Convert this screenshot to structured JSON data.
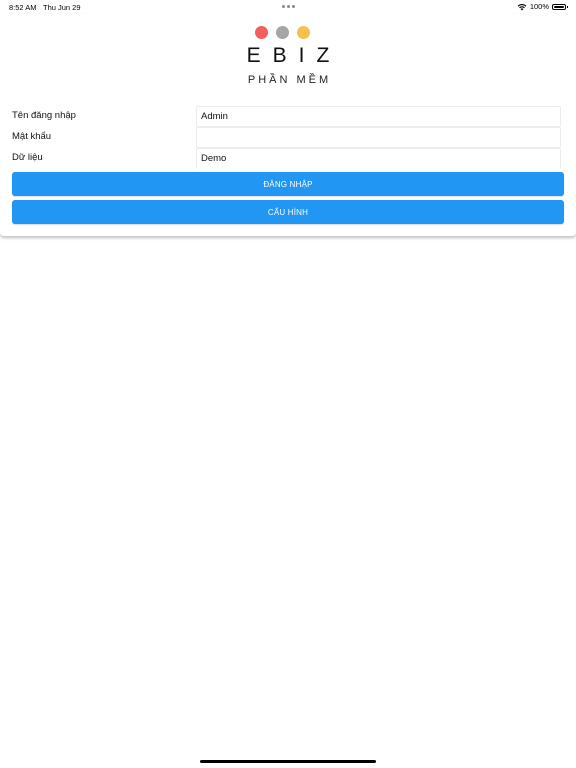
{
  "status_bar": {
    "time": "8:52 AM",
    "date": "Thu Jun 29",
    "battery": "100%"
  },
  "logo": {
    "title": "EBIZ",
    "subtitle": "PHẦN MỀM",
    "dot_colors": [
      "#f25f5c",
      "#a5a5a5",
      "#f7c04a"
    ]
  },
  "form": {
    "username": {
      "label": "Tên đăng nhập",
      "value": "Admin",
      "placeholder": ""
    },
    "password": {
      "label": "Mật khẩu",
      "value": "",
      "placeholder": ""
    },
    "data": {
      "label": "Dữ liệu",
      "value": "Demo",
      "placeholder": ""
    }
  },
  "buttons": {
    "login": "ĐĂNG NHẬP",
    "config": "CẤU HÌNH"
  },
  "colors": {
    "accent": "#2196f3"
  },
  "icons": [
    "wifi-icon",
    "battery-icon",
    "multitasking-dots-icon"
  ]
}
